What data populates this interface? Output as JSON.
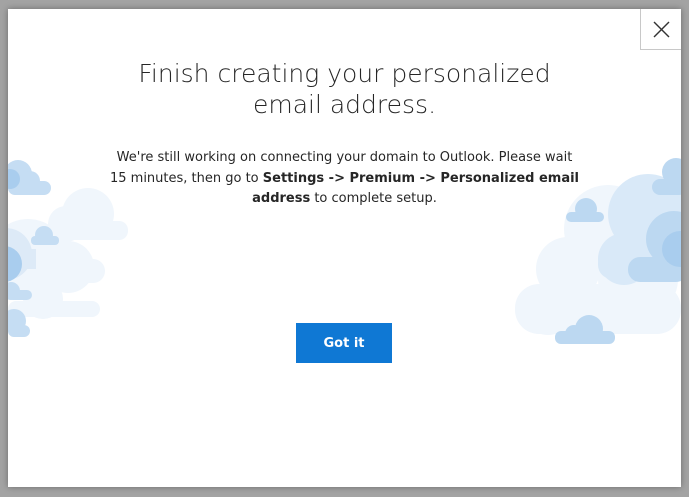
{
  "dialog": {
    "title_line1": "Finish creating your personalized",
    "title_line2": "email address.",
    "message_part1": "We're still working on connecting your domain to Outlook. Please wait 15 minutes, then go to ",
    "message_bold": "Settings -> Premium -> Personalized email address",
    "message_part2": " to complete setup.",
    "primary_button_label": "Got it",
    "close_icon": "close-icon"
  },
  "colors": {
    "accent": "#0f78d4",
    "cloud_light": "#e8f1fb",
    "cloud_mid": "#cfe3f6",
    "cloud_dark": "#a9cdee"
  }
}
